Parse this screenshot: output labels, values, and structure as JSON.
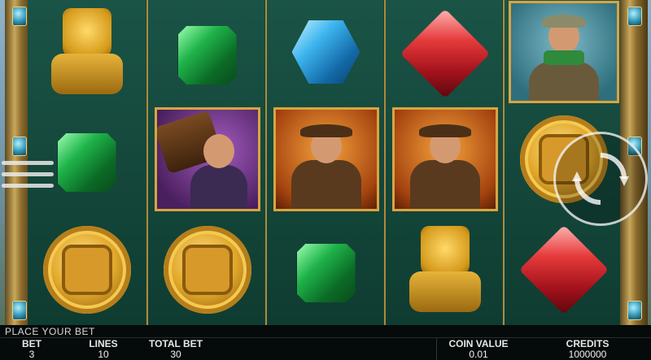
{
  "game": {
    "reels": [
      [
        "idol",
        "gem-green",
        "coin"
      ],
      [
        "gem-green",
        "character-porter",
        "coin"
      ],
      [
        "gem-blue",
        "character-explorer",
        "gem-green"
      ],
      [
        "gem-red",
        "character-explorer",
        "idol"
      ],
      [
        "character-lady-explorer",
        "coin",
        "gem-red"
      ]
    ]
  },
  "status": {
    "message": "PLACE YOUR BET"
  },
  "bottom_bar": {
    "bet_label": "BET",
    "bet_value": "3",
    "lines_label": "LINES",
    "lines_value": "10",
    "total_bet_label": "TOTAL BET",
    "total_bet_value": "30",
    "coin_value_label": "COIN VALUE",
    "coin_value_value": "0.01",
    "credits_label": "CREDITS",
    "credits_value": "1000000"
  },
  "controls": {
    "menu_icon": "hamburger-icon",
    "spin_icon": "spin-arrows-icon"
  }
}
